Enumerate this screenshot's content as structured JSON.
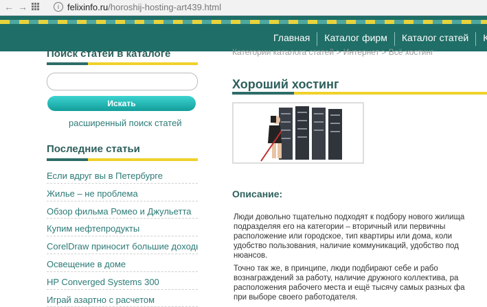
{
  "browser": {
    "url_domain": "felixinfo.ru",
    "url_path": "/horoshij-hosting-art439.html",
    "icons": [
      "back-arrow-icon",
      "forward-arrow-icon",
      "apps-grid-icon",
      "info-icon"
    ]
  },
  "header": {
    "menu": [
      "Главная",
      "Каталог фирм",
      "Каталог статей",
      "К"
    ]
  },
  "sidebar": {
    "search_title": "Поиск статей в каталоге",
    "search_button": "Искать",
    "advanced_link": "расширенный поиск статей",
    "latest_title": "Последние статьи",
    "articles": [
      "Если вдруг вы в Петербурге",
      "Жилье – не проблема",
      "Обзор фильма Ромео и Джульетта",
      "Купим нефтепродукты",
      "CorelDraw приносит большие доходы",
      "Освещение в доме",
      "HP Converged Systems 300",
      "Играй азартно с расчетом"
    ]
  },
  "main": {
    "breadcrumb": "Категории каталога статей > Интернет > Всё хостинг",
    "title": "Хороший хостинг",
    "description_label": "Описание:",
    "paragraph1": [
      "Люди довольно тщательно подходят к подбору нового жилища",
      "подразделяя его на категории – вторичный или первичны",
      "расположение или городское, тип квартиры или дома, коли",
      "удобство пользования, наличие коммуникаций, удобство под",
      "нюансов."
    ],
    "paragraph2": [
      "Точно так же, в принципе, люди подбирают себе и рабо",
      "вознаграждений за работу, наличие дружного коллектива, ра",
      "расположения рабочего места и ещё тысячу самых разных фа",
      "при выборе своего работодателя."
    ]
  },
  "colors": {
    "header": "#1f6e67",
    "accent_yellow": "#f0d12a",
    "accent_teal": "#2d6d67",
    "link": "#2b7a76",
    "button": "#139e9b"
  }
}
